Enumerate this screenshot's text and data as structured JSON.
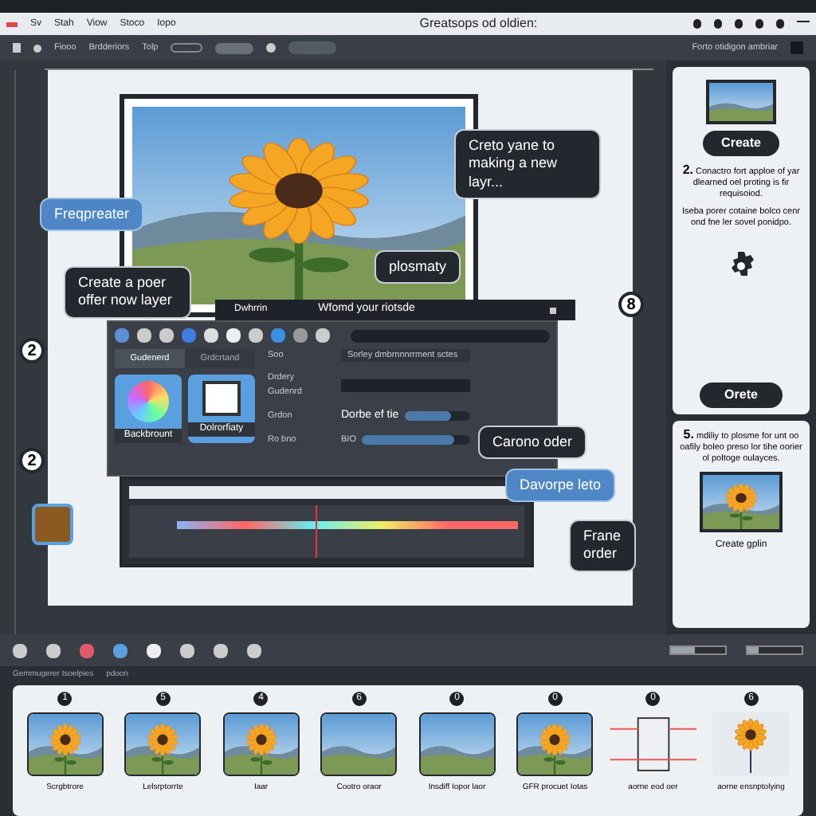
{
  "menu": {
    "items": [
      "Sv",
      "Stah",
      "Viow",
      "Stoco",
      "Iopo"
    ],
    "title": "Greatsops od oldien:"
  },
  "toolbar": {
    "items": [
      "Fiooo",
      "Brdderiors",
      "Tolp"
    ],
    "right_label": "Forto otidigon ambriar"
  },
  "canvas": {
    "callouts": [
      {
        "kind": "dark",
        "text": "Creto yane to making a new layr..."
      },
      {
        "kind": "blue",
        "text": "Freqpreater"
      },
      {
        "kind": "dark",
        "text": "Create a poer offer now layer"
      },
      {
        "kind": "dark",
        "text": "plosmaty"
      },
      {
        "kind": "dark",
        "text": "Carono oder"
      },
      {
        "kind": "blue",
        "text": "Davorpe leto"
      },
      {
        "kind": "dark",
        "text": "Frane order"
      }
    ],
    "markers": [
      "2",
      "2",
      "8"
    ],
    "strip": {
      "left": "Dwhrrin",
      "right": "Wfomd your riotsde"
    },
    "panel": {
      "tabs": [
        {
          "label": "Gudenerd",
          "selected": true
        },
        {
          "label": "Grdcrtand",
          "selected": false
        }
      ],
      "swatches": [
        {
          "kind": "gradient",
          "label": "Backbrount"
        },
        {
          "kind": "paper",
          "label": "Dolrorfiaty"
        }
      ],
      "rows": [
        {
          "label": "Soo",
          "value": "Sorley dmbrnnnrrment sctes"
        },
        {
          "label": "Drdery Gudenrd",
          "value": ""
        },
        {
          "label": "Grdon",
          "value": "Dorbe ef tie",
          "level": 0.7
        },
        {
          "label": "Ro bno",
          "value": "BIO",
          "level": 0.85
        }
      ]
    },
    "timeline": {
      "playhead": {
        "level": 0.47
      }
    }
  },
  "side": {
    "button1": "Create",
    "step1": {
      "num": "2.",
      "text": "Conactro fort apploe of yar dlearned oel proting is fir requisoiod."
    },
    "note": "Iseba porer cotaine bolco cenr ond fne ler sovel ponidpo.",
    "button2": "Orete",
    "step2": {
      "num": "5.",
      "text": "mdiliy to plosme for unt oo oafily boleo preso lor tihe oorier ol poltoge oulayces."
    },
    "caption": "Create gplin"
  },
  "zoom_sliders": [
    {
      "level": 0.45
    },
    {
      "level": 0.2
    }
  ],
  "filmstrip": {
    "title": "Gemmugerer tsoelpies",
    "subtitle": "pdoon",
    "frames": [
      {
        "num": "1",
        "kind": "sunflower",
        "caption": "Scrgbtrore"
      },
      {
        "num": "5",
        "kind": "sunflower",
        "caption": "Lelsrptorrte"
      },
      {
        "num": "4",
        "kind": "sunflower",
        "caption": "Iaar"
      },
      {
        "num": "6",
        "kind": "landscape",
        "caption": "Cootro oraor"
      },
      {
        "num": "0",
        "kind": "landscape",
        "caption": "Insdiff Iopor laor"
      },
      {
        "num": "0",
        "kind": "sunflower",
        "caption": "GFR procuet Iotas"
      },
      {
        "num": "0",
        "kind": "diagram",
        "caption": "aorne eod oer"
      },
      {
        "num": "6",
        "kind": "sketch",
        "caption": "aorne ensnptolying"
      }
    ]
  }
}
